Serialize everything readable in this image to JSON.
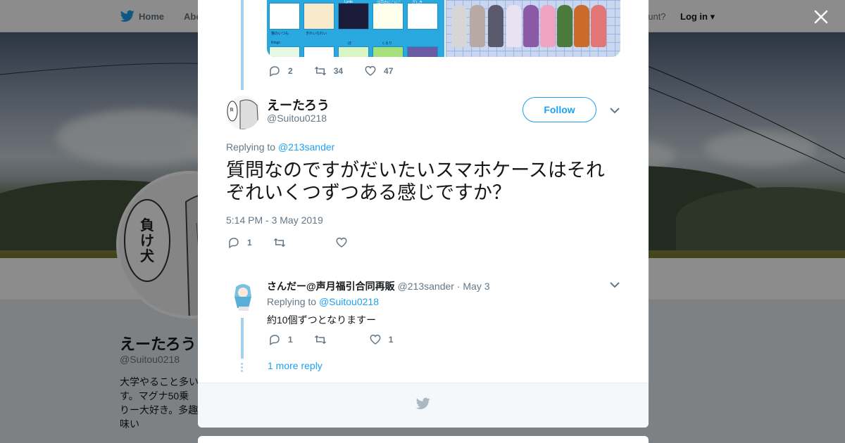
{
  "nav": {
    "home_label": "Home",
    "about_label": "Abo",
    "account_prompt": "ccount?",
    "login_label": "Log in"
  },
  "profile": {
    "name": "えーたろう",
    "handle": "@Suitou0218",
    "bio": "大学やること多いす。マグナ50乗りー大好き。多趣味い"
  },
  "previous_tweet": {
    "reply_count": "2",
    "retweet_count": "34",
    "like_count": "47",
    "media_labels": [
      "猫のいつも",
      "きれいなれい",
      "Lynte",
      "江戸のにこにこ",
      "ざしき",
      "Ringo",
      "ぼ",
      "くるり"
    ]
  },
  "main_tweet": {
    "name": "えーたろう",
    "handle": "@Suitou0218",
    "follow_label": "Follow",
    "replying_prefix": "Replying to",
    "replying_to": "@213sander",
    "text": "質問なのですがだいたいスマホケースはそれぞれいくつずつある感じですか？",
    "timestamp": "5:14 PM - 3 May 2019",
    "reply_count": "1",
    "retweet_count": "",
    "like_count": ""
  },
  "reply_tweet": {
    "name": "さんだー@声月福引合同再販",
    "handle": "@213sander",
    "date": "· May 3",
    "replying_prefix": "Replying to",
    "replying_to": "@Suitou0218",
    "text": "約10個ずつとなりますー",
    "reply_count": "1",
    "retweet_count": "",
    "like_count": "1"
  },
  "more_replies_label": "1 more reply",
  "colors": {
    "accent": "#1da1f2",
    "thread_line": "#a5d0ec",
    "muted": "#657786"
  },
  "icons": [
    "twitter-bird-icon",
    "close-icon",
    "reply-icon",
    "retweet-icon",
    "like-icon",
    "chevron-down-icon"
  ]
}
